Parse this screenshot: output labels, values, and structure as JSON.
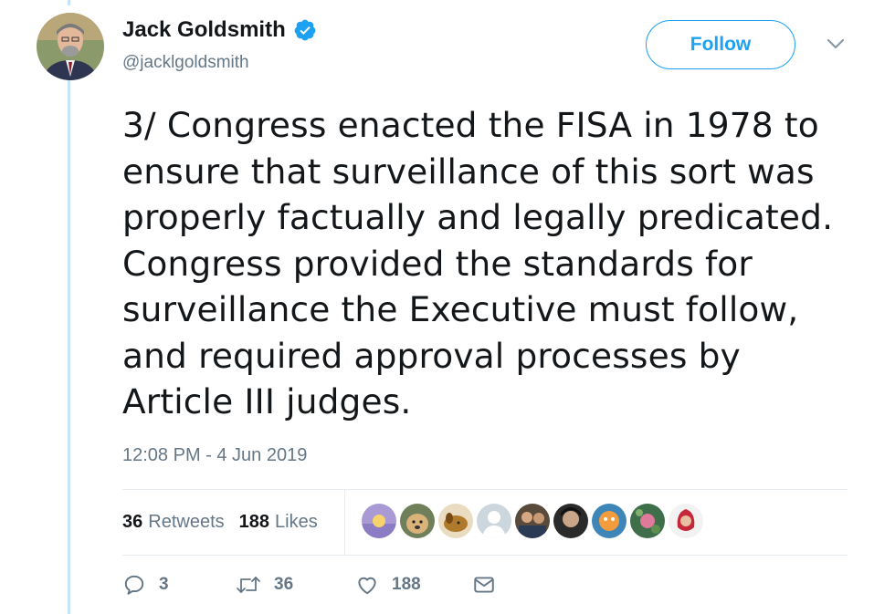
{
  "author": {
    "name": "Jack Goldsmith",
    "handle": "@jacklgoldsmith",
    "verified": true
  },
  "follow_label": "Follow",
  "tweet": {
    "text": "3/ Congress enacted the FISA in 1978 to\nensure that surveillance of this sort was\nproperly factually and legally predicated.\nCongress provided the standards for\nsurveillance the Executive must follow,\nand required approval processes by\nArticle III judges.",
    "timestamp": "12:08 PM - 4 Jun 2019"
  },
  "stats": {
    "retweets_count": "36",
    "retweets_label": "Retweets",
    "likes_count": "188",
    "likes_label": "Likes"
  },
  "liker_avatars": [
    "avatar-1",
    "avatar-2",
    "avatar-3",
    "avatar-4",
    "avatar-5",
    "avatar-6",
    "avatar-7",
    "avatar-8",
    "avatar-9"
  ],
  "actions": {
    "reply_count": "3",
    "retweet_count": "36",
    "like_count": "188"
  },
  "colors": {
    "accent": "#1da1f2",
    "secondary_text": "#657786",
    "thread_line": "#c4e4f7"
  }
}
